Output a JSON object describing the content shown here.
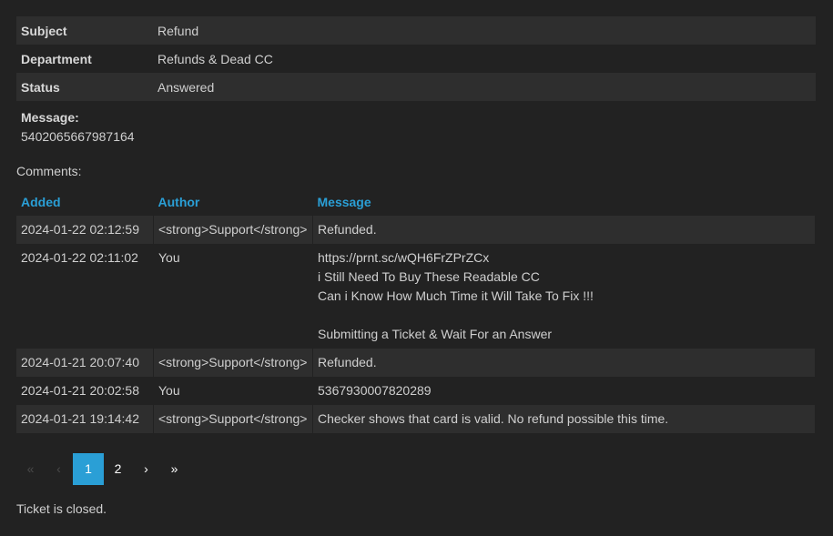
{
  "ticket": {
    "subject_label": "Subject",
    "subject_value": "Refund",
    "department_label": "Department",
    "department_value": "Refunds & Dead CC",
    "status_label": "Status",
    "status_value": "Answered",
    "message_label": "Message:",
    "message_value": "5402065667987164"
  },
  "comments": {
    "label": "Comments:",
    "headers": {
      "added": "Added",
      "author": "Author",
      "message": "Message"
    },
    "rows": [
      {
        "added": "2024-01-22 02:12:59",
        "author": "<strong>Support</strong>",
        "message": [
          "Refunded."
        ]
      },
      {
        "added": "2024-01-22 02:11:02",
        "author": "You",
        "message": [
          "https://prnt.sc/wQH6FrZPrZCx",
          "i Still Need To Buy These Readable CC",
          "Can i Know How Much Time it Will Take To Fix !!!",
          "",
          "Submitting a Ticket & Wait For an Answer"
        ]
      },
      {
        "added": "2024-01-21 20:07:40",
        "author": "<strong>Support</strong>",
        "message": [
          "Refunded."
        ]
      },
      {
        "added": "2024-01-21 20:02:58",
        "author": "You",
        "message": [
          "5367930007820289"
        ]
      },
      {
        "added": "2024-01-21 19:14:42",
        "author": "<strong>Support</strong>",
        "message": [
          "Checker shows that card is valid. No refund possible this time."
        ]
      }
    ]
  },
  "pagination": {
    "first": "«",
    "prev": "‹",
    "pages": [
      "1",
      "2"
    ],
    "current": "1",
    "next": "›",
    "last": "»"
  },
  "footer": {
    "status_text": "Ticket is closed."
  },
  "colors": {
    "accent": "#2a9fd6",
    "background": "#222222",
    "stripe": "#2e2e2e"
  }
}
